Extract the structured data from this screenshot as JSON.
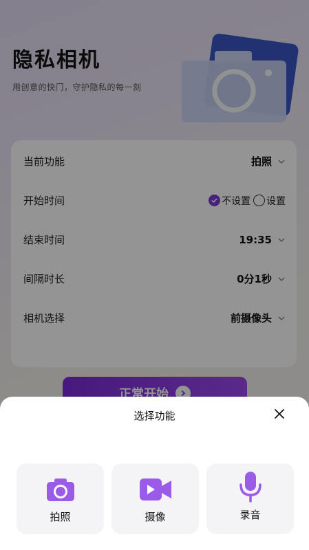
{
  "hero": {
    "title": "隐私相机",
    "subtitle": "用创意的快门，守护隐私的每一刻"
  },
  "settings": {
    "current_function": {
      "label": "当前功能",
      "value": "拍照"
    },
    "start_time": {
      "label": "开始时间",
      "option_unset": "不设置",
      "option_set": "设置",
      "selected": "不设置"
    },
    "end_time": {
      "label": "结束时间",
      "value": "19:35"
    },
    "interval": {
      "label": "间隔时长",
      "value": "0分1秒"
    },
    "camera": {
      "label": "相机选择",
      "value": "前摄像头"
    }
  },
  "start_button": {
    "label": "正常开始"
  },
  "sheet": {
    "title": "选择功能",
    "options": [
      {
        "label": "拍照",
        "icon": "camera-icon"
      },
      {
        "label": "摄像",
        "icon": "video-camera-icon"
      },
      {
        "label": "录音",
        "icon": "microphone-icon"
      }
    ]
  },
  "colors": {
    "accent": "#7c3ad6",
    "icon_purple": "#9a5be6",
    "button_gradient_start": "#7a2bd8",
    "button_gradient_end": "#9a49ec"
  }
}
